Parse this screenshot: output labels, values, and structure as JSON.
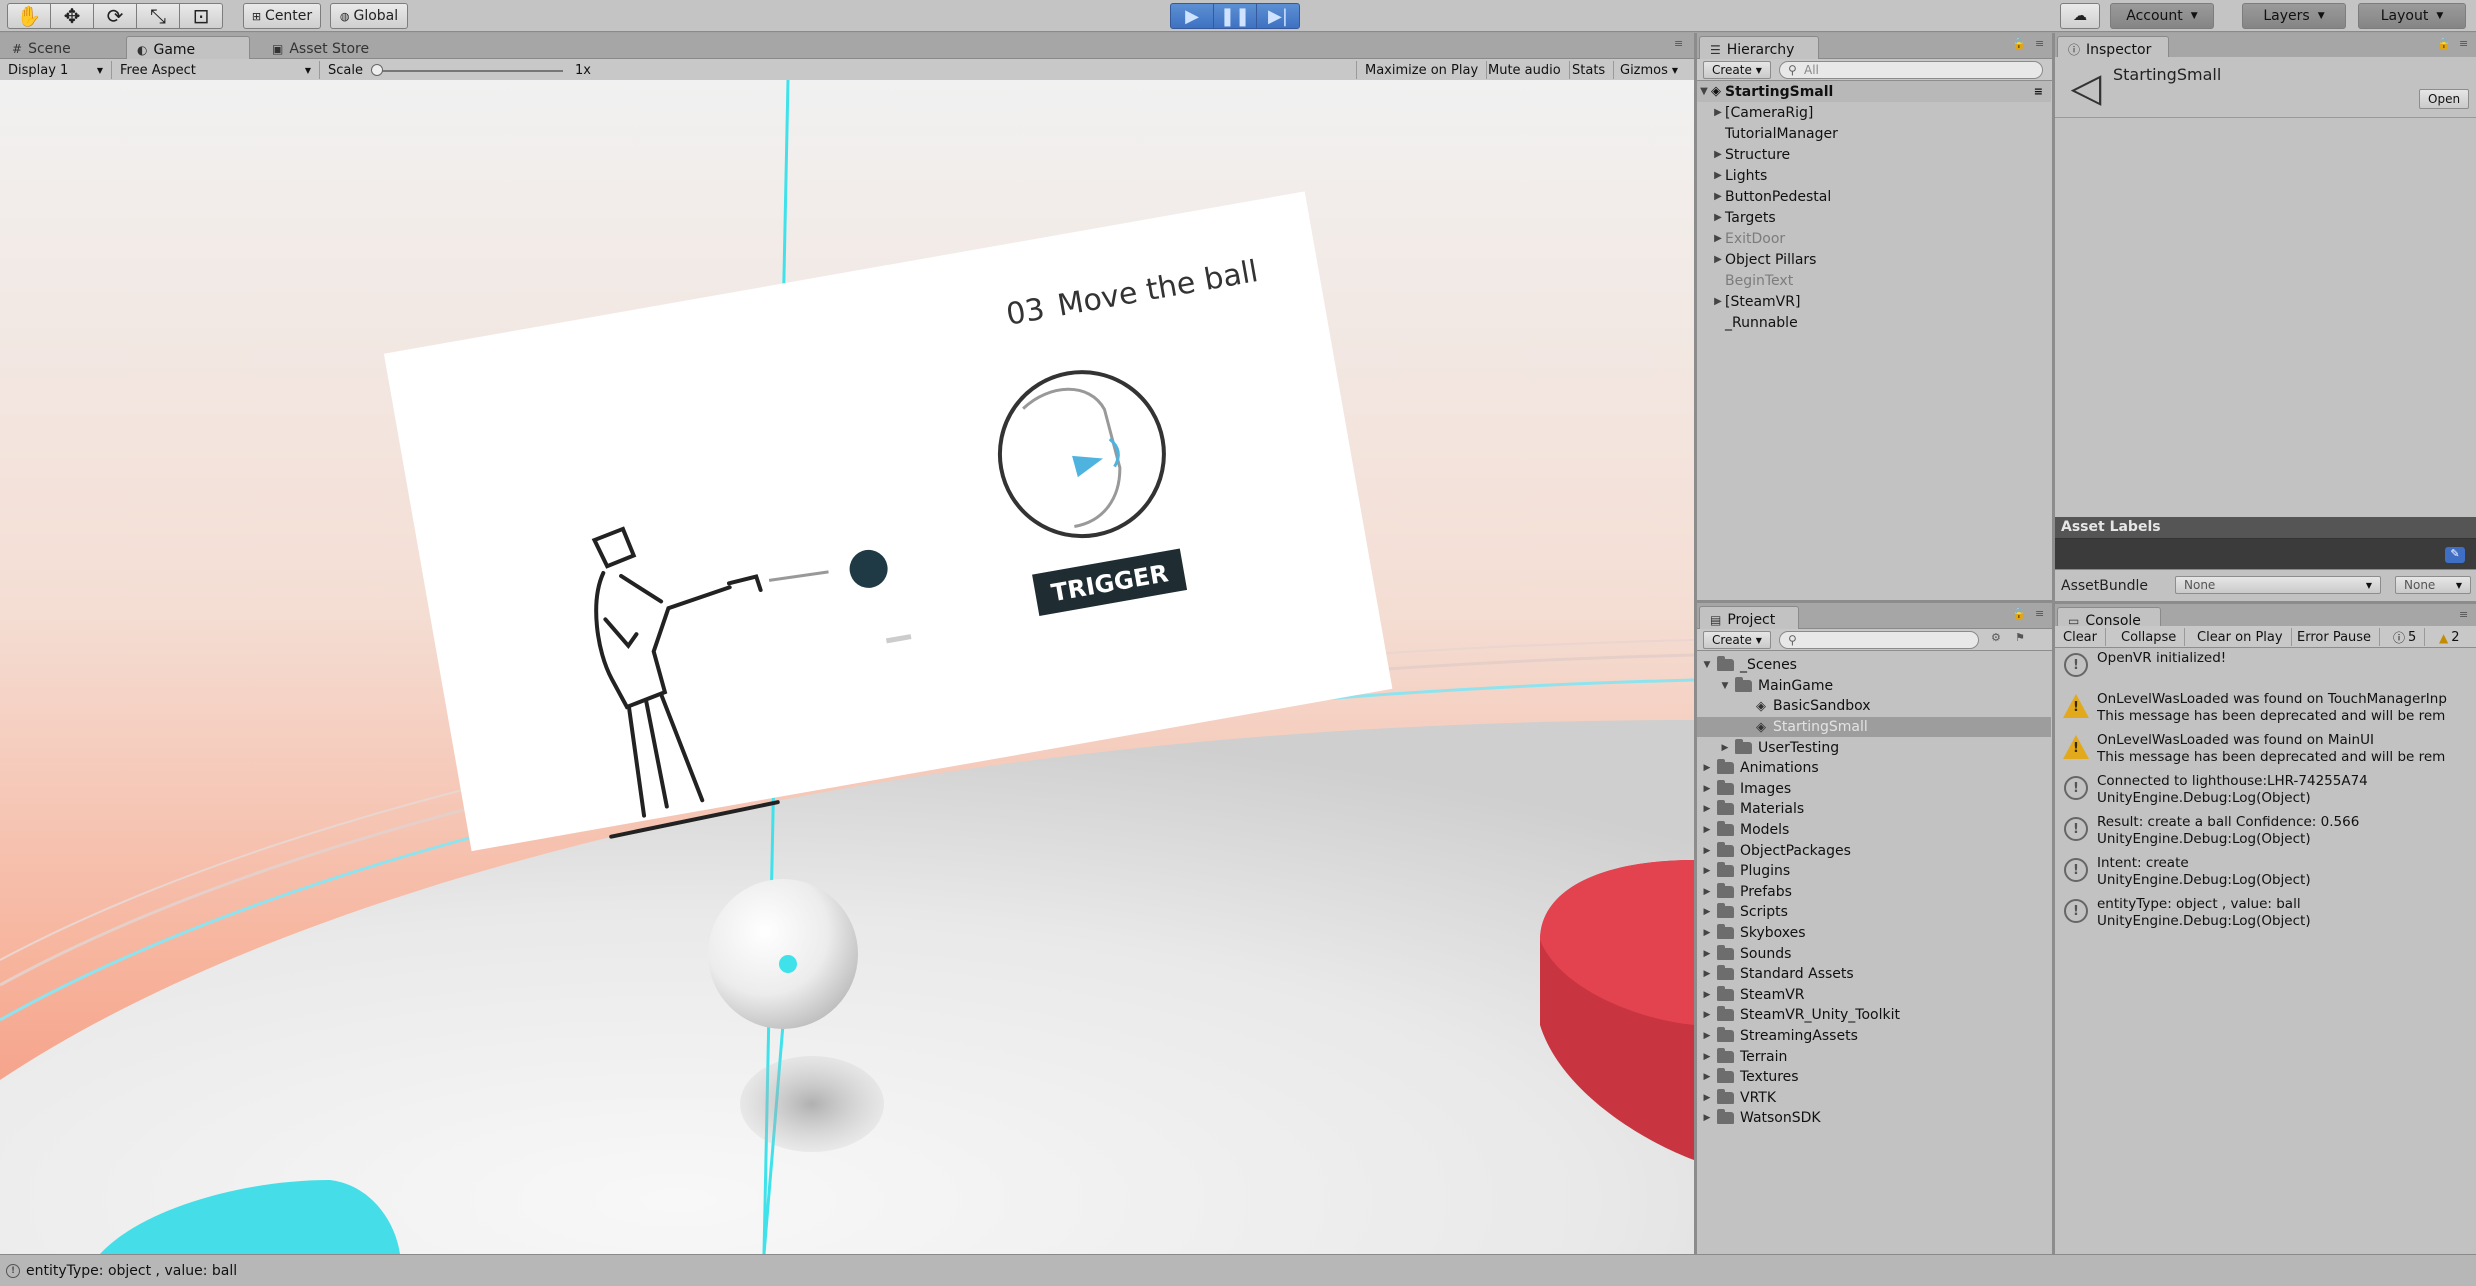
{
  "toolbar": {
    "pivot_center": "Center",
    "pivot_global": "Global",
    "account": "Account",
    "layers": "Layers",
    "layout": "Layout"
  },
  "scene_panel": {
    "tabs": [
      "Scene",
      "Game",
      "Asset Store"
    ],
    "display": "Display 1",
    "aspect": "Free Aspect",
    "scale_label": "Scale",
    "scale_value": "1x",
    "maximize_on_play": "Maximize on Play",
    "mute_audio": "Mute audio",
    "stats": "Stats",
    "gizmos": "Gizmos"
  },
  "game": {
    "card_step": "03",
    "card_title": "Move the ball",
    "trigger_label": "TRIGGER",
    "colors": {
      "red_disc": "#e0404c",
      "cyan_disc": "#45dde8",
      "ray": "#3fe2ea",
      "sky_salmon": "#f5a28c"
    }
  },
  "hierarchy": {
    "title": "Hierarchy",
    "create": "Create",
    "search_placeholder": "All",
    "root": "StartingSmall",
    "items": [
      {
        "label": "[CameraRig]",
        "fold": true,
        "dim": false
      },
      {
        "label": "TutorialManager",
        "fold": false,
        "dim": false
      },
      {
        "label": "Structure",
        "fold": true,
        "dim": false
      },
      {
        "label": "Lights",
        "fold": true,
        "dim": false
      },
      {
        "label": "ButtonPedestal",
        "fold": true,
        "dim": false
      },
      {
        "label": "Targets",
        "fold": true,
        "dim": false
      },
      {
        "label": "ExitDoor",
        "fold": true,
        "dim": true
      },
      {
        "label": "Object Pillars",
        "fold": true,
        "dim": false
      },
      {
        "label": "BeginText",
        "fold": false,
        "dim": true
      },
      {
        "label": "[SteamVR]",
        "fold": true,
        "dim": false
      },
      {
        "label": "_Runnable",
        "fold": false,
        "dim": false
      }
    ]
  },
  "inspector": {
    "title": "Inspector",
    "object_name": "StartingSmall",
    "open_button": "Open",
    "asset_labels": "Asset Labels",
    "asset_bundle_label": "AssetBundle",
    "asset_bundle_value": "None",
    "asset_variant_value": "None"
  },
  "project": {
    "title": "Project",
    "create": "Create",
    "items": [
      {
        "label": "_Scenes",
        "depth": 0,
        "fold": "open",
        "type": "folder"
      },
      {
        "label": "MainGame",
        "depth": 1,
        "fold": "open",
        "type": "folder"
      },
      {
        "label": "BasicSandbox",
        "depth": 2,
        "fold": "none",
        "type": "scene"
      },
      {
        "label": "StartingSmall",
        "depth": 2,
        "fold": "none",
        "type": "scene",
        "selected": true
      },
      {
        "label": "UserTesting",
        "depth": 1,
        "fold": "closed",
        "type": "folder"
      },
      {
        "label": "Animations",
        "depth": 0,
        "fold": "closed",
        "type": "folder"
      },
      {
        "label": "Images",
        "depth": 0,
        "fold": "closed",
        "type": "folder"
      },
      {
        "label": "Materials",
        "depth": 0,
        "fold": "closed",
        "type": "folder"
      },
      {
        "label": "Models",
        "depth": 0,
        "fold": "closed",
        "type": "folder"
      },
      {
        "label": "ObjectPackages",
        "depth": 0,
        "fold": "closed",
        "type": "folder"
      },
      {
        "label": "Plugins",
        "depth": 0,
        "fold": "closed",
        "type": "folder"
      },
      {
        "label": "Prefabs",
        "depth": 0,
        "fold": "closed",
        "type": "folder"
      },
      {
        "label": "Scripts",
        "depth": 0,
        "fold": "closed",
        "type": "folder"
      },
      {
        "label": "Skyboxes",
        "depth": 0,
        "fold": "closed",
        "type": "folder"
      },
      {
        "label": "Sounds",
        "depth": 0,
        "fold": "closed",
        "type": "folder"
      },
      {
        "label": "Standard Assets",
        "depth": 0,
        "fold": "closed",
        "type": "folder"
      },
      {
        "label": "SteamVR",
        "depth": 0,
        "fold": "closed",
        "type": "folder"
      },
      {
        "label": "SteamVR_Unity_Toolkit",
        "depth": 0,
        "fold": "closed",
        "type": "folder"
      },
      {
        "label": "StreamingAssets",
        "depth": 0,
        "fold": "closed",
        "type": "folder"
      },
      {
        "label": "Terrain",
        "depth": 0,
        "fold": "closed",
        "type": "folder"
      },
      {
        "label": "Textures",
        "depth": 0,
        "fold": "closed",
        "type": "folder"
      },
      {
        "label": "VRTK",
        "depth": 0,
        "fold": "closed",
        "type": "folder"
      },
      {
        "label": "WatsonSDK",
        "depth": 0,
        "fold": "closed",
        "type": "folder"
      }
    ]
  },
  "console": {
    "title": "Console",
    "clear": "Clear",
    "collapse": "Collapse",
    "clear_on_play": "Clear on Play",
    "error_pause": "Error Pause",
    "info_count": "5",
    "warn_count": "2",
    "messages": [
      {
        "type": "info",
        "line1": "OpenVR initialized!",
        "line2": ""
      },
      {
        "type": "warn",
        "line1": "OnLevelWasLoaded was found on TouchManagerInp",
        "line2": "This message has been deprecated and will be rem"
      },
      {
        "type": "warn",
        "line1": "OnLevelWasLoaded was found on MainUI",
        "line2": "This message has been deprecated and will be rem"
      },
      {
        "type": "info",
        "line1": "Connected to lighthouse:LHR-74255A74",
        "line2": "UnityEngine.Debug:Log(Object)"
      },
      {
        "type": "info",
        "line1": "Result: create a ball  Confidence: 0.566",
        "line2": "UnityEngine.Debug:Log(Object)"
      },
      {
        "type": "info",
        "line1": "Intent: create",
        "line2": "UnityEngine.Debug:Log(Object)"
      },
      {
        "type": "info",
        "line1": "entityType: object , value: ball",
        "line2": "UnityEngine.Debug:Log(Object)"
      }
    ]
  },
  "status": {
    "text": "entityType: object , value: ball"
  }
}
